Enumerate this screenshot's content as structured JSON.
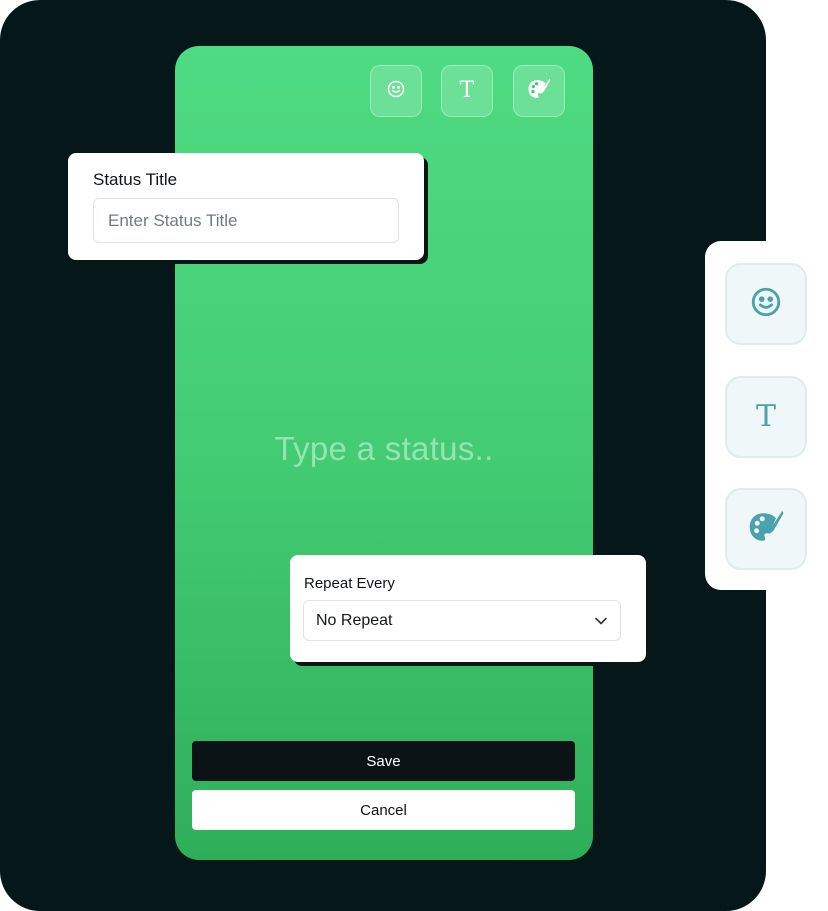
{
  "editor": {
    "status_placeholder": "Type a status..",
    "toolbar": {
      "emoji_icon": "smiley-icon",
      "text_icon": "text-icon",
      "text_glyph": "T",
      "palette_icon": "palette-icon"
    }
  },
  "status_title_card": {
    "label": "Status Title",
    "placeholder": "Enter Status Title",
    "value": ""
  },
  "repeat_card": {
    "label": "Repeat Every",
    "selected": "No Repeat"
  },
  "actions": {
    "save_label": "Save",
    "cancel_label": "Cancel"
  },
  "side_toolbar": {
    "items": [
      {
        "icon": "smiley-icon"
      },
      {
        "icon": "text-icon",
        "glyph": "T"
      },
      {
        "icon": "palette-icon"
      }
    ]
  },
  "colors": {
    "backdrop": "#06171a",
    "phone_gradient_top": "#4fdb83",
    "phone_gradient_bottom": "#2fae5a",
    "accent_icon": "#4aa2ad",
    "save_button": "#0c1316"
  }
}
